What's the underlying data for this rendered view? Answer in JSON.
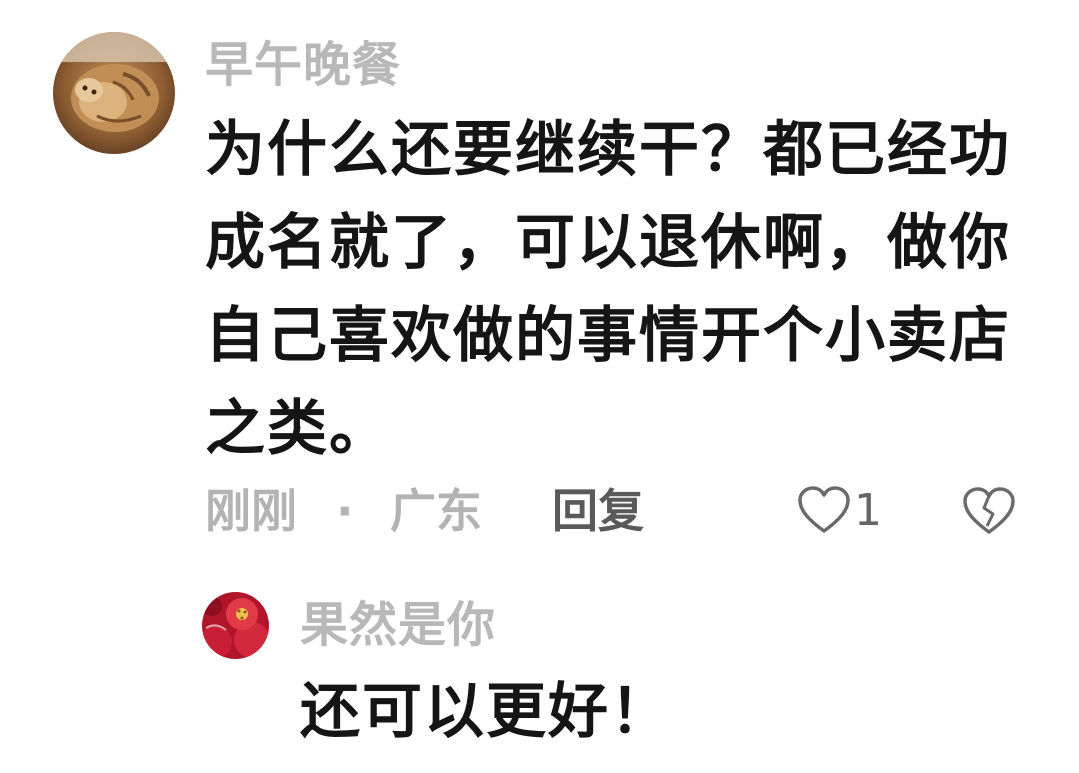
{
  "comments": [
    {
      "avatar": {
        "icon": "cat-avatar-icon"
      },
      "username": "早午晚餐",
      "text": "为什么还要继续干？都已经功成名就了，可以退休啊，做你自己喜欢做的事情开个小卖店之类。",
      "time": "刚刚",
      "separator": "·",
      "location": "广东",
      "reply_label": "回复",
      "like_count": "1",
      "colors": {
        "username": "#b8b8b8",
        "text": "#151515",
        "meta": "#b3b3b3",
        "reply": "#5a5a5a"
      }
    }
  ],
  "reply": {
    "avatar": {
      "icon": "red-flower-avatar-icon"
    },
    "username": "果然是你",
    "text": "还可以更好！"
  }
}
